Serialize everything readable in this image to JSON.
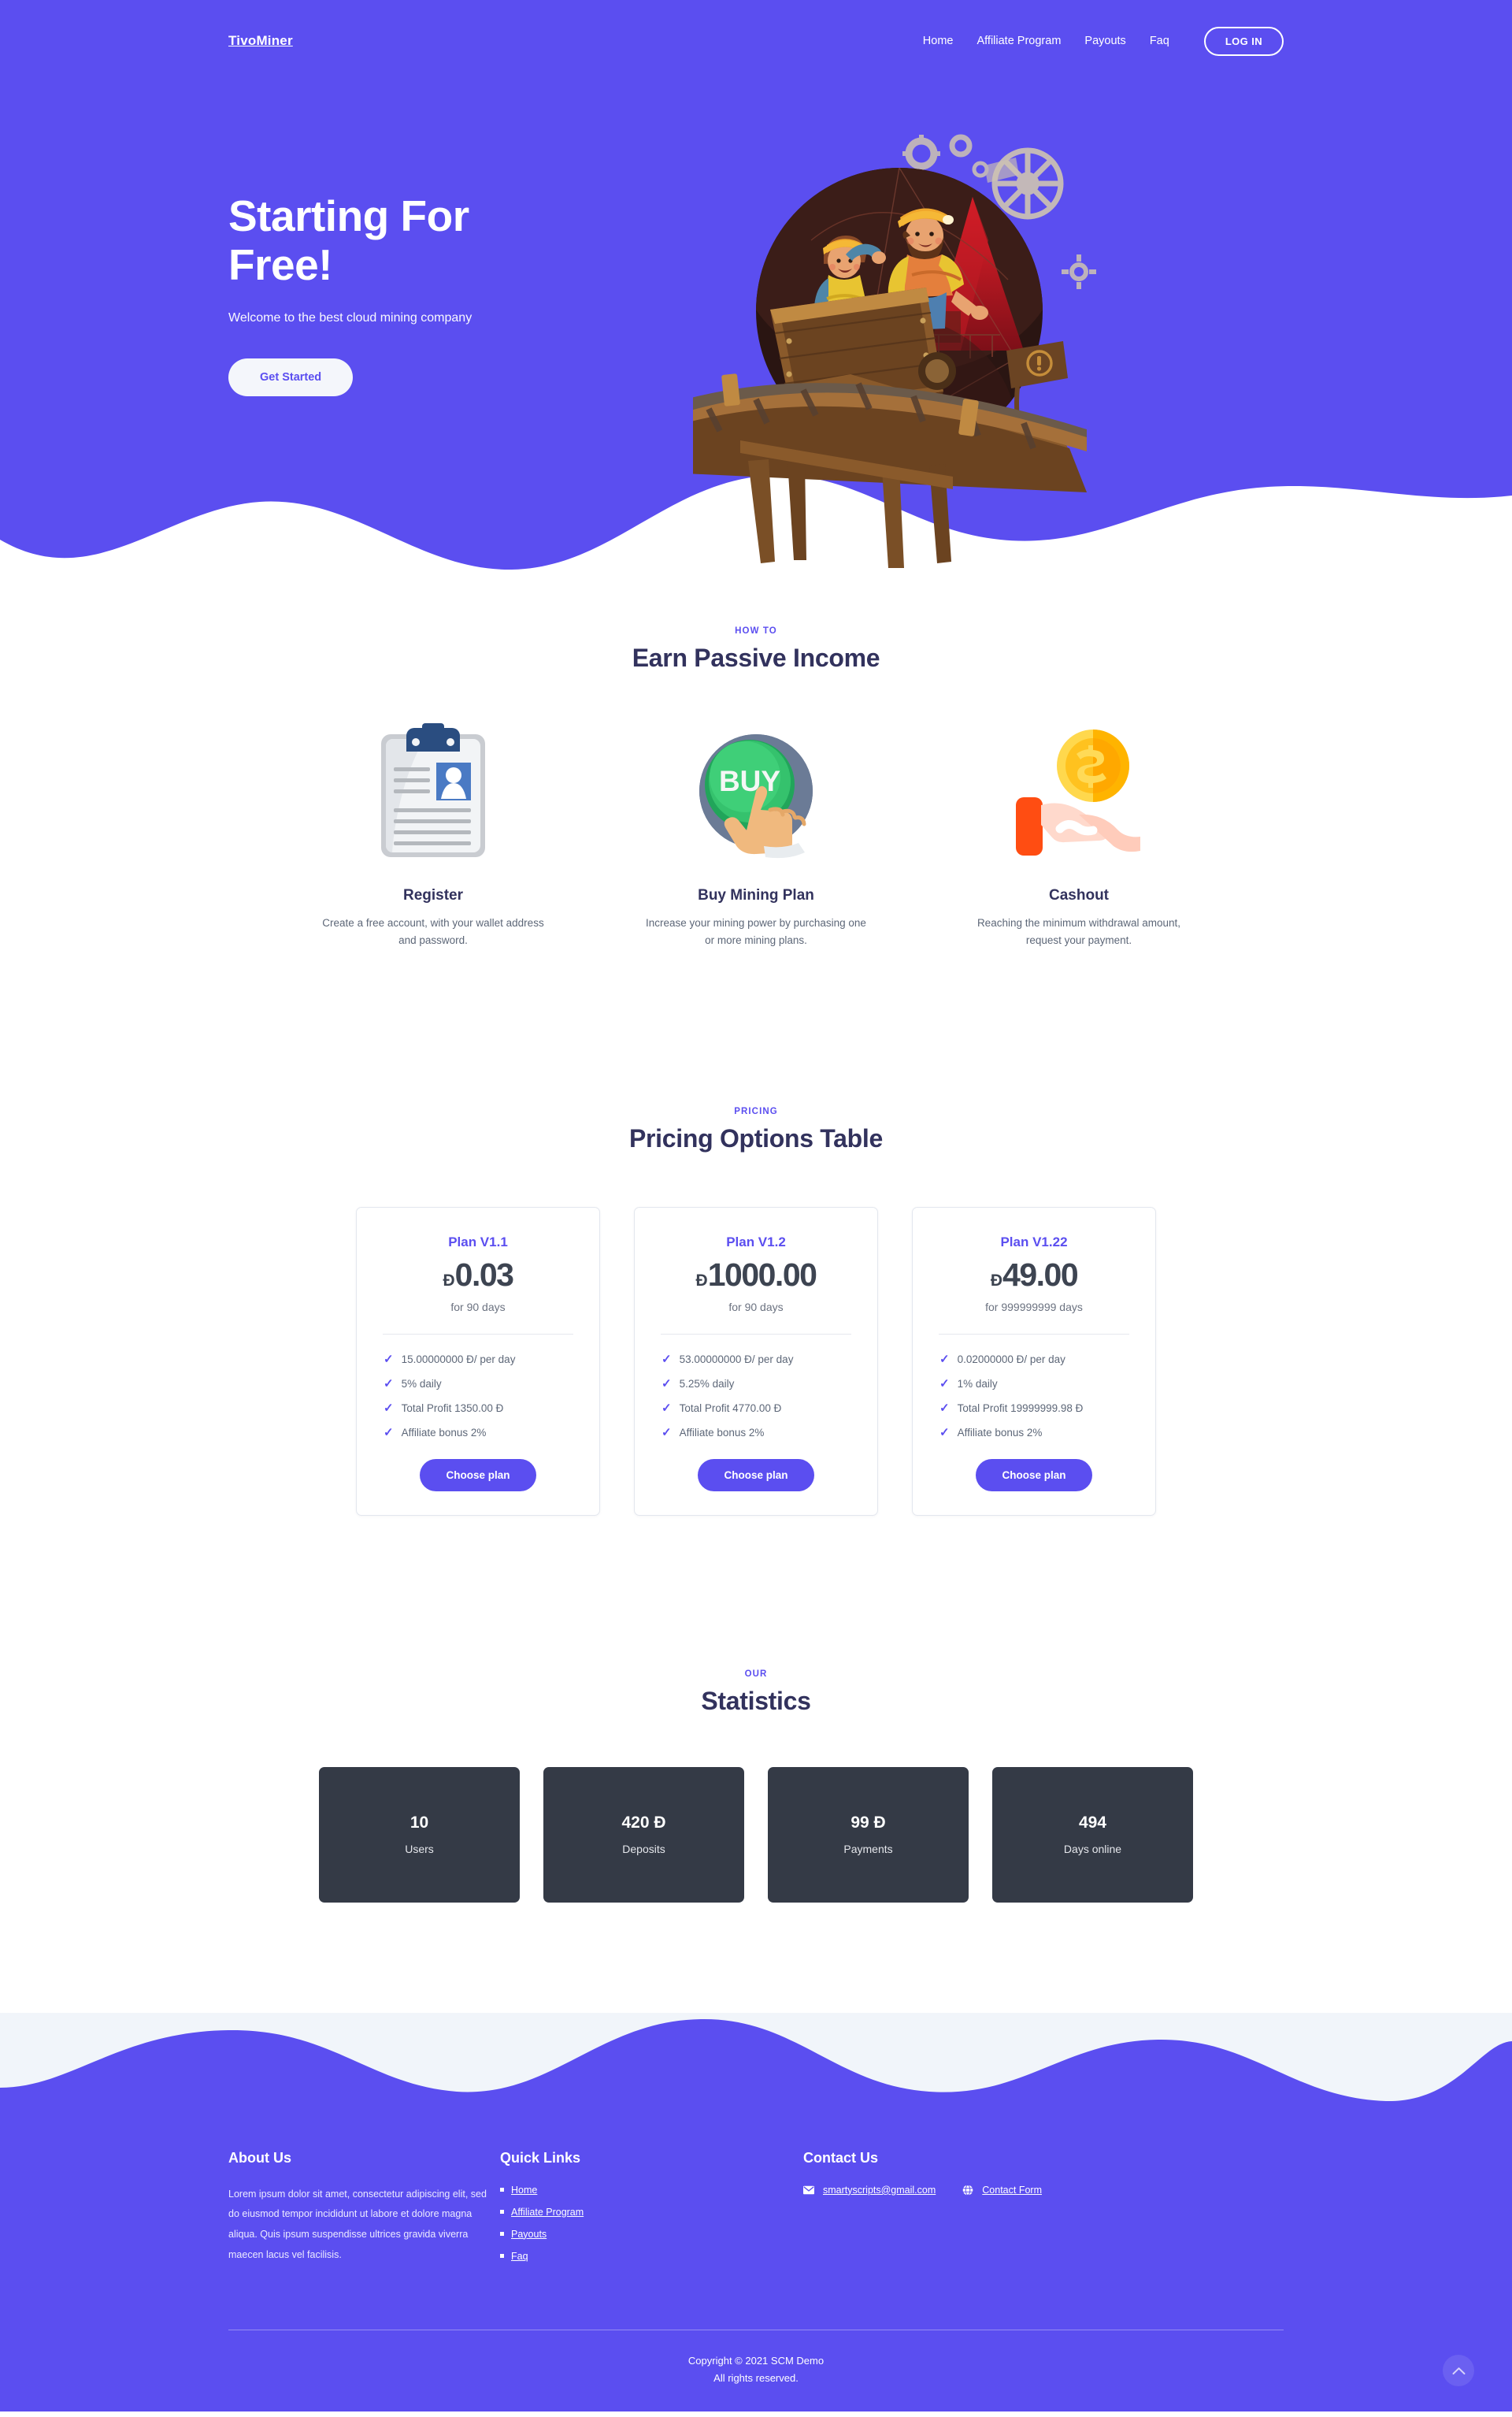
{
  "brand": {
    "name": "TivoMiner",
    "accent": "#5b4ef0",
    "dark": "#343a46"
  },
  "nav": {
    "links": [
      {
        "label": "Home"
      },
      {
        "label": "Affiliate Program"
      },
      {
        "label": "Payouts"
      },
      {
        "label": "Faq"
      }
    ],
    "login_label": "LOG IN"
  },
  "hero": {
    "title_line1": "Starting For",
    "title_line2": "Free!",
    "subtitle": "Welcome to the best cloud mining company",
    "cta_label": "Get Started",
    "illustration": "mining-cart-illustration"
  },
  "howto": {
    "kicker": "HOW TO",
    "title": "Earn Passive Income",
    "cards": [
      {
        "icon": "clipboard-resume-icon",
        "name": "Register",
        "desc": "Create a free account, with your wallet address and password."
      },
      {
        "icon": "buy-button-click-icon",
        "name": "Buy Mining Plan",
        "desc": "Increase your mining power by purchasing one or more mining plans."
      },
      {
        "icon": "hand-coin-icon",
        "name": "Cashout",
        "desc": "Reaching the minimum withdrawal amount, request your payment."
      }
    ]
  },
  "pricing": {
    "kicker": "PRICING",
    "title": "Pricing Options Table",
    "button_label": "Choose plan",
    "plans": [
      {
        "name": "Plan V1.1",
        "currency": "Đ",
        "amount": "0.03",
        "term": "for 90 days",
        "features": [
          "15.00000000 Đ/ per day",
          "5% daily",
          "Total Profit 1350.00 Đ",
          "Affiliate bonus 2%"
        ]
      },
      {
        "name": "Plan V1.2",
        "currency": "Đ",
        "amount": "1000.00",
        "term": "for 90 days",
        "features": [
          "53.00000000 Đ/ per day",
          "5.25% daily",
          "Total Profit 4770.00 Đ",
          "Affiliate bonus 2%"
        ]
      },
      {
        "name": "Plan V1.22",
        "currency": "Đ",
        "amount": "49.00",
        "term": "for 999999999 days",
        "features": [
          "0.02000000 Đ/ per day",
          "1% daily",
          "Total Profit 19999999.98 Đ",
          "Affiliate bonus 2%"
        ]
      }
    ]
  },
  "stats": {
    "kicker": "OUR",
    "title": "Statistics",
    "items": [
      {
        "value": "10",
        "label": "Users"
      },
      {
        "value": "420 Đ",
        "label": "Deposits"
      },
      {
        "value": "99 Đ",
        "label": "Payments"
      },
      {
        "value": "494",
        "label": "Days online"
      }
    ]
  },
  "footer": {
    "about": {
      "heading": "About Us",
      "text": "Lorem ipsum dolor sit amet, consectetur adipiscing elit, sed do eiusmod tempor incididunt ut labore et dolore magna aliqua. Quis ipsum suspendisse ultrices gravida viverra maecen lacus vel facilisis."
    },
    "quick_links": {
      "heading": "Quick Links",
      "items": [
        {
          "label": "Home"
        },
        {
          "label": "Affiliate Program"
        },
        {
          "label": "Payouts"
        },
        {
          "label": "Faq"
        }
      ]
    },
    "contact": {
      "heading": "Contact Us",
      "email": "smartyscripts@gmail.com",
      "email_icon": "envelope-icon",
      "form_label": "Contact Form",
      "form_icon": "globe-icon"
    },
    "copyright_line1": "Copyright © 2021 SCM Demo",
    "copyright_line2": "All rights reserved.",
    "to_top_icon": "chevron-up-icon"
  }
}
